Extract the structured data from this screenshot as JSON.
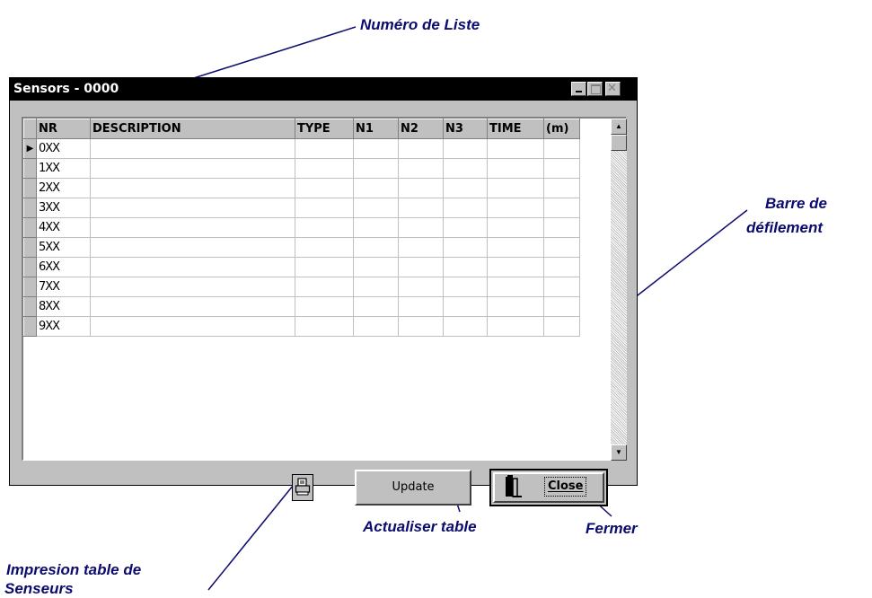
{
  "window": {
    "title": "Sensors - 0000",
    "controls": [
      "minimize-icon",
      "maximize-icon",
      "close-icon"
    ]
  },
  "table": {
    "columns": [
      "NR",
      "DESCRIPTION",
      "TYPE",
      "N1",
      "N2",
      "N3",
      "TIME",
      "(m)"
    ],
    "rows": [
      {
        "nr": "0XX"
      },
      {
        "nr": "1XX"
      },
      {
        "nr": "2XX"
      },
      {
        "nr": "3XX"
      },
      {
        "nr": "4XX"
      },
      {
        "nr": "5XX"
      },
      {
        "nr": "6XX"
      },
      {
        "nr": "7XX"
      },
      {
        "nr": "8XX"
      },
      {
        "nr": "9XX"
      }
    ],
    "current_row_indicator": "▶"
  },
  "buttons": {
    "print_icon": "printer-icon",
    "update_label": "Update",
    "close_label": "Close",
    "close_icon": "door-icon"
  },
  "callouts": {
    "list_number": "Numéro de Liste",
    "scrollbar_line1": "Barre de",
    "scrollbar_line2": "défilement",
    "update_table": "Actualiser table",
    "close": "Fermer",
    "print_line1": "Impresion table de",
    "print_line2": "Senseurs"
  },
  "colors": {
    "callout_text": "#0c0c6e",
    "titlebar": "#000000",
    "window_face": "#c0c0c0"
  }
}
